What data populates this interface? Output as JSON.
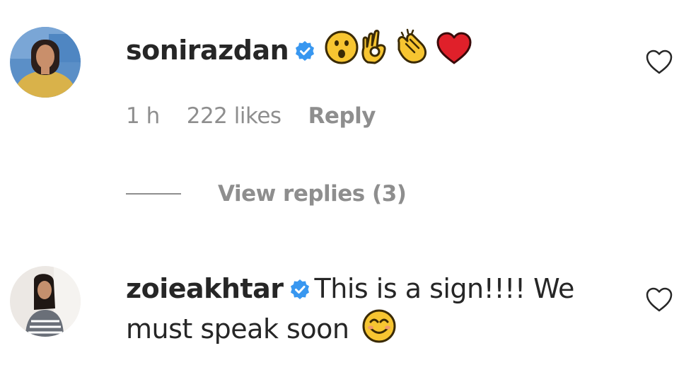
{
  "comments": [
    {
      "username": "sonirazdan",
      "verified": true,
      "text": "",
      "emojis": [
        "surprised-face-emoji",
        "ok-hand-emoji",
        "clapping-hands-emoji",
        "red-heart-emoji"
      ],
      "time": "1 h",
      "likes": "222 likes",
      "reply_label": "Reply",
      "view_replies_label": "View replies (3)"
    },
    {
      "username": "zoieakhtar",
      "verified": true,
      "text_line1": "This is a sign!!!! We",
      "text_line2": "must speak soon",
      "emojis": [
        "smiling-face-emoji"
      ]
    }
  ],
  "colors": {
    "username": "#262626",
    "meta": "#8e8e8e",
    "verified_blue": "#3897f0",
    "heart_outline": "#262626",
    "emoji_yellow": "#f7c531",
    "emoji_red": "#e0202a"
  }
}
